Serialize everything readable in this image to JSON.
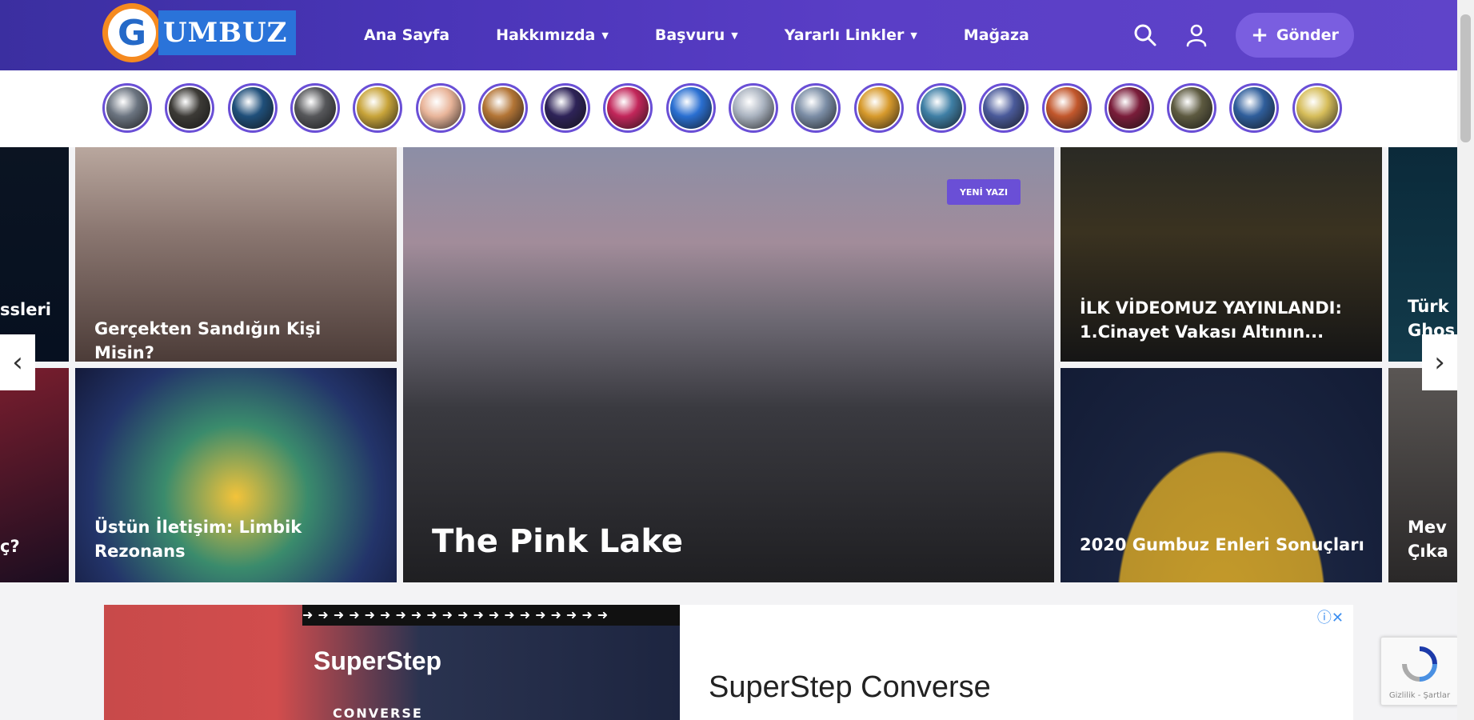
{
  "header": {
    "logo_letter": "G",
    "logo_text": "UMBUZ",
    "nav": [
      {
        "label": "Ana Sayfa",
        "caret": false
      },
      {
        "label": "Hakkımızda",
        "caret": true
      },
      {
        "label": "Başvuru",
        "caret": true
      },
      {
        "label": "Yararlı Linkler",
        "caret": true
      },
      {
        "label": "Mağaza",
        "caret": false
      }
    ],
    "send_label": "Gönder",
    "search_icon": "search-icon",
    "user_icon": "user-icon"
  },
  "stories": {
    "count": 20,
    "colors": [
      "#6b7480",
      "#3c3a36",
      "#1f4f7a",
      "#56575a",
      "#c8a43a",
      "#e9b59a",
      "#b37536",
      "#2e2358",
      "#c2265a",
      "#2a6fd1",
      "#aab3c0",
      "#7c8ea6",
      "#d79a2c",
      "#3f7fa5",
      "#4a5a9a",
      "#c2572c",
      "#7a1d3a",
      "#5d5a40",
      "#2f5e9b",
      "#d6bd5a"
    ]
  },
  "featured": {
    "main": {
      "title": "The Pink Lake",
      "badge": "YENİ YAZI"
    },
    "cards": [
      {
        "title": "Gerçekten Sandığın Kişi Misin?"
      },
      {
        "title": "Üstün İletişim: Limbik Rezonans"
      },
      {
        "title": "İLK VİDEOMUZ YAYINLANDI: 1.Cinayet Vakası Altının..."
      },
      {
        "title": "2020 Gumbuz Enleri Sonuçları"
      }
    ],
    "left_partial_top": "ssleri",
    "left_partial_bottom": "ç?",
    "right_partial_top_1": "Türk",
    "right_partial_top_2": "Ghos",
    "right_partial_bottom_1": "Mev",
    "right_partial_bottom_2": "Çıka",
    "prev_arrow": "‹",
    "next_arrow": "›"
  },
  "ad": {
    "brand": "SuperStep",
    "sub": "CONVERSE",
    "title": "SuperStep Converse",
    "close": "ⓘ✕"
  },
  "recaptcha": {
    "text": "Gizlilik - Şartlar"
  }
}
